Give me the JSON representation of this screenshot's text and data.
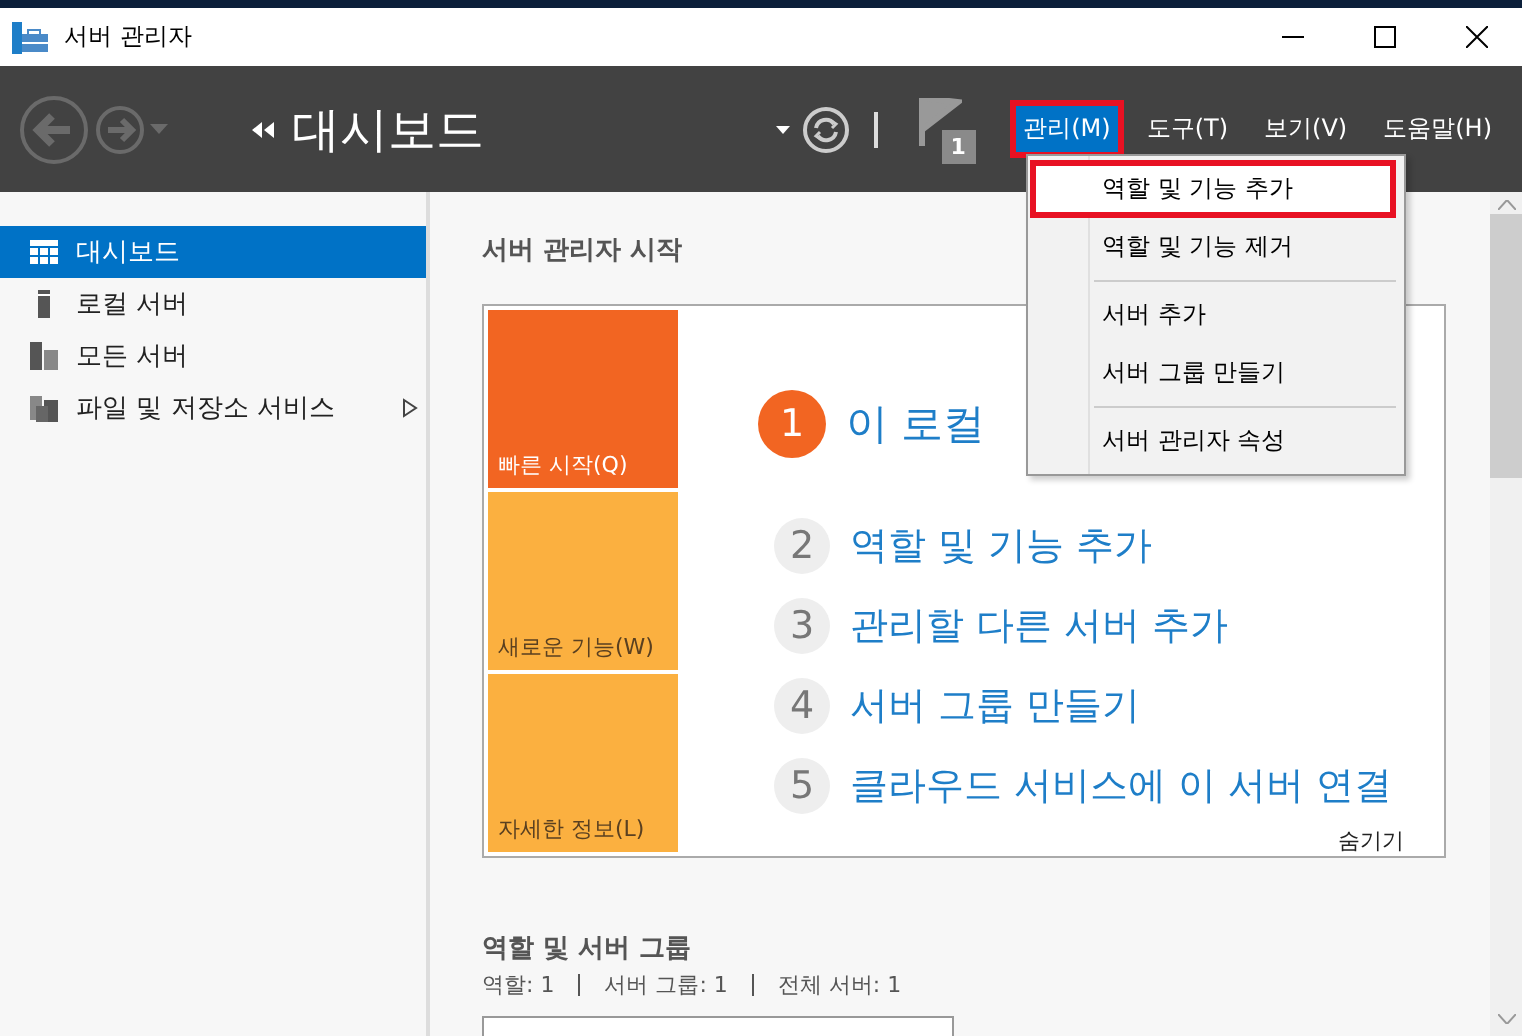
{
  "window": {
    "title": "서버 관리자"
  },
  "toolbar": {
    "title": "대시보드",
    "notification_count": "1",
    "menus": [
      {
        "label": "관리(M)",
        "selected": true,
        "highlighted": true
      },
      {
        "label": "도구(T)",
        "selected": false,
        "highlighted": false
      },
      {
        "label": "보기(V)",
        "selected": false,
        "highlighted": false
      },
      {
        "label": "도움말(H)",
        "selected": false,
        "highlighted": false
      }
    ]
  },
  "dropdown": [
    {
      "kind": "item",
      "label": "역할 및 기능 추가",
      "highlighted": true
    },
    {
      "kind": "item",
      "label": "역할 및 기능 제거",
      "highlighted": false
    },
    {
      "kind": "separator"
    },
    {
      "kind": "item",
      "label": "서버 추가",
      "highlighted": false
    },
    {
      "kind": "item",
      "label": "서버 그룹 만들기",
      "highlighted": false
    },
    {
      "kind": "separator"
    },
    {
      "kind": "item",
      "label": "서버 관리자 속성",
      "highlighted": false
    }
  ],
  "sidebar": {
    "items": [
      {
        "kind": "dashboard",
        "label": "대시보드",
        "selected": true,
        "expandable": false
      },
      {
        "kind": "server",
        "label": "로컬 서버",
        "selected": false,
        "expandable": false
      },
      {
        "kind": "servers",
        "label": "모든 서버",
        "selected": false,
        "expandable": false
      },
      {
        "kind": "storage",
        "label": "파일 및 저장소 서비스",
        "selected": false,
        "expandable": true
      }
    ]
  },
  "welcome": {
    "heading": "서버 관리자 시작",
    "tiles": [
      {
        "label": "빠른 시작(Q)",
        "selected": true
      },
      {
        "label": "새로운 기능(W)",
        "selected": false
      },
      {
        "label": "자세한 정보(L)",
        "selected": false
      }
    ],
    "steps": [
      {
        "kind": "main",
        "number": "1",
        "label": "이 로컬"
      },
      {
        "kind": "step",
        "number": "2",
        "label": "역할 및 기능 추가"
      },
      {
        "kind": "step",
        "number": "3",
        "label": "관리할 다른 서버 추가"
      },
      {
        "kind": "step",
        "number": "4",
        "label": "서버 그룹 만들기"
      },
      {
        "kind": "step",
        "number": "5",
        "label": "클라우드 서비스에 이 서버 연결"
      }
    ],
    "hide_link": "숨기기"
  },
  "roles": {
    "heading": "역할 및 서버 그룹",
    "counts": [
      "역할: 1",
      "서버 그룹: 1",
      "전체 서버: 1"
    ]
  }
}
